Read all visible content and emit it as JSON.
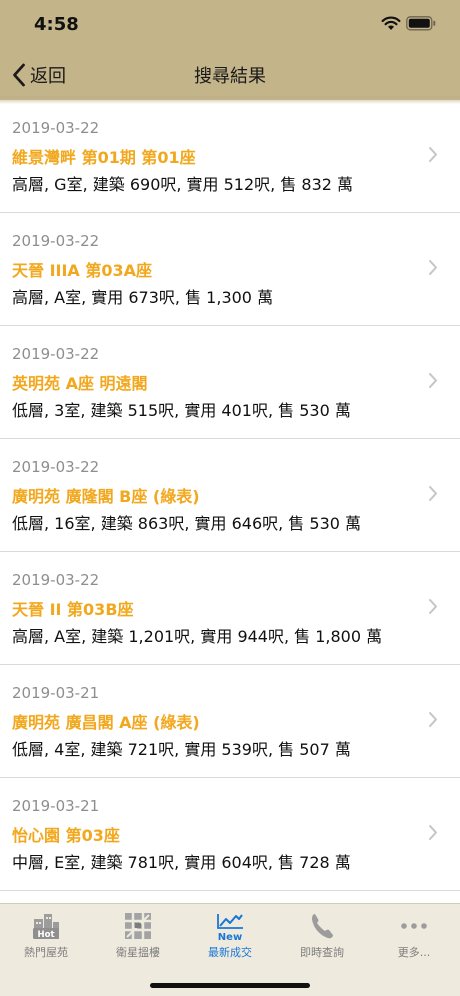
{
  "status_bar": {
    "time": "4:58"
  },
  "nav": {
    "back_label": "返回",
    "title": "搜尋結果"
  },
  "results": [
    {
      "date": "2019-03-22",
      "name": "維景灣畔 第01期 第01座",
      "detail": "高層, G室, 建築 690呎, 實用 512呎, 售 832 萬"
    },
    {
      "date": "2019-03-22",
      "name": "天晉 IIIA 第03A座",
      "detail": "高層, A室, 實用 673呎, 售 1,300 萬"
    },
    {
      "date": "2019-03-22",
      "name": "英明苑 A座 明遠閣",
      "detail": "低層, 3室, 建築 515呎, 實用 401呎, 售 530 萬"
    },
    {
      "date": "2019-03-22",
      "name": "廣明苑 廣隆閣 B座 (綠表)",
      "detail": "低層, 16室, 建築 863呎, 實用 646呎, 售 530 萬"
    },
    {
      "date": "2019-03-22",
      "name": "天晉 II 第03B座",
      "detail": "高層, A室, 建築 1,201呎, 實用 944呎, 售 1,800 萬"
    },
    {
      "date": "2019-03-21",
      "name": "廣明苑 廣昌閣 A座 (綠表)",
      "detail": "低層, 4室, 建築 721呎, 實用 539呎, 售 507 萬"
    },
    {
      "date": "2019-03-21",
      "name": "怡心園 第03座",
      "detail": "中層, E室, 建築 781呎, 實用 604呎, 售 728 萬"
    }
  ],
  "tabs": [
    {
      "label": "熱門屋苑",
      "icon": "hot-buildings-icon",
      "badge": "Hot"
    },
    {
      "label": "衛星搵樓",
      "icon": "satellite-map-icon"
    },
    {
      "label": "最新成交",
      "icon": "new-transactions-icon",
      "badge": "New",
      "active": true
    },
    {
      "label": "即時查詢",
      "icon": "phone-icon"
    },
    {
      "label": "更多...",
      "icon": "more-icon"
    }
  ],
  "colors": {
    "header": "#c4b48a",
    "accent": "#f2a81e",
    "tab_active": "#1877d6",
    "tabbar": "#efeade"
  }
}
